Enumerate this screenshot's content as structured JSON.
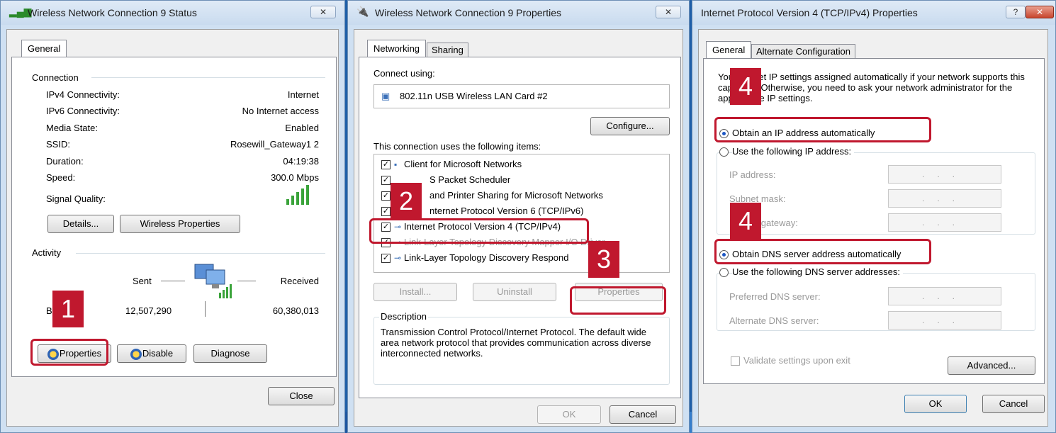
{
  "status": {
    "title": "Wireless Network Connection 9 Status",
    "close_x": "✕",
    "tab_general": "General",
    "connection_label": "Connection",
    "rows": [
      {
        "label": "IPv4 Connectivity:",
        "value": "Internet"
      },
      {
        "label": "IPv6 Connectivity:",
        "value": "No Internet access"
      },
      {
        "label": "Media State:",
        "value": "Enabled"
      },
      {
        "label": "SSID:",
        "value": "Rosewill_Gateway1 2"
      },
      {
        "label": "Duration:",
        "value": "04:19:38"
      },
      {
        "label": "Speed:",
        "value": "300.0 Mbps"
      }
    ],
    "signal_label": "Signal Quality:",
    "details_button": "Details...",
    "wireless_properties_button": "Wireless Properties",
    "activity_label": "Activity",
    "sent_label": "Sent",
    "received_label": "Received",
    "bytes_label": "B",
    "sent_value": "12,507,290",
    "received_value": "60,380,013",
    "properties_button": "Properties",
    "disable_button": "Disable",
    "diagnose_button": "Diagnose",
    "close_button": "Close"
  },
  "properties": {
    "title": "Wireless Network Connection 9 Properties",
    "close_x": "✕",
    "tab_networking": "Networking",
    "tab_sharing": "Sharing",
    "connect_using_label": "Connect using:",
    "adapter_name": "802.11n USB Wireless LAN Card #2",
    "configure_button": "Configure...",
    "items_label": "This connection uses the following items:",
    "items": [
      {
        "label": "Client for Microsoft Networks",
        "checked": true
      },
      {
        "label": "S Packet Scheduler",
        "checked": true
      },
      {
        "label": "and Printer Sharing for Microsoft Networks",
        "checked": true
      },
      {
        "label": "nternet Protocol Version 6 (TCP/IPv6)",
        "checked": true
      },
      {
        "label": "Internet Protocol Version 4 (TCP/IPv4)",
        "checked": true
      },
      {
        "label": "Link-Layer Topology Discovery Mapper I/O Driver",
        "checked": true
      },
      {
        "label": "Link-Layer Topology Discovery Respond",
        "checked": true
      }
    ],
    "install_button": "Install...",
    "uninstall_button": "Uninstall",
    "properties_button": "Properties",
    "description_label": "Description",
    "description_text": "Transmission Control Protocol/Internet Protocol. The default wide area network protocol that provides communication across diverse interconnected networks.",
    "ok_button": "OK",
    "cancel_button": "Cancel"
  },
  "ipv4": {
    "title": "Internet Protocol Version 4 (TCP/IPv4) Properties",
    "help_x": "?",
    "close_x": "✕",
    "tab_general": "General",
    "tab_alternate": "Alternate Configuration",
    "intro_text": "You can get IP settings assigned automatically if your network supports this capability. Otherwise, you need to ask your network administrator for the appropriate IP settings.",
    "obtain_ip_auto": "Obtain an IP address automatically",
    "use_following_ip": "Use the following IP address:",
    "ip_address_label": "IP address:",
    "subnet_mask_label": "Subnet mask:",
    "default_gateway_label": "Default gateway:",
    "obtain_dns_auto": "Obtain DNS server address automatically",
    "use_following_dns": "Use the following DNS server addresses:",
    "preferred_dns_label": "Preferred DNS server:",
    "alternate_dns_label": "Alternate DNS server:",
    "ip_placeholder": "...",
    "validate_label": "Validate settings upon exit",
    "advanced_button": "Advanced...",
    "ok_button": "OK",
    "cancel_button": "Cancel"
  },
  "callouts": {
    "step1": "1",
    "step2": "2",
    "step3": "3",
    "step4a": "4",
    "step4b": "4"
  },
  "colors": {
    "highlight": "#c0182e",
    "desktop": "#1f5fa8",
    "chrome": "#cfe0f2"
  }
}
